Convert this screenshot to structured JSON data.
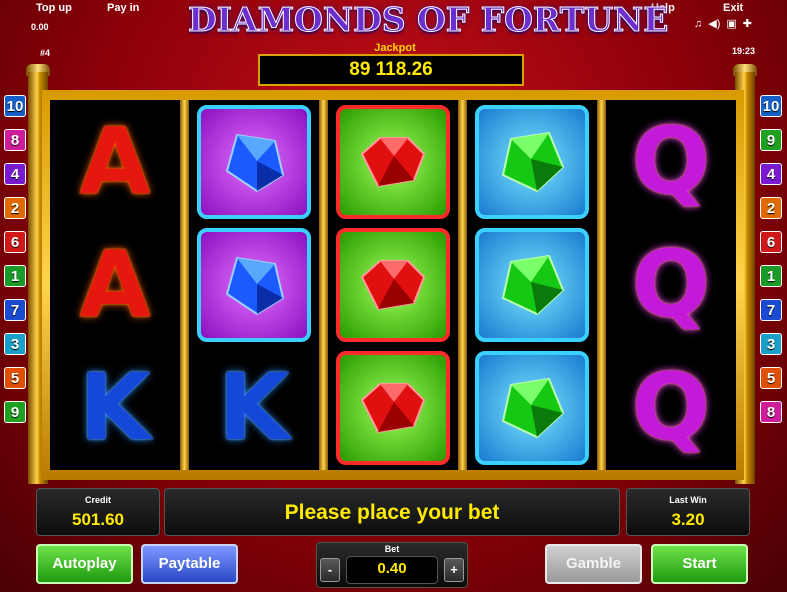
{
  "topbar": {
    "top_up": "Top up",
    "pay_in": "Pay in",
    "help": "Help",
    "exit": "Exit",
    "balance": "0.00",
    "game_id": "#4",
    "clock": "19:23",
    "icons": [
      "music-icon",
      "sound-icon",
      "settings-icon",
      "fullscreen-icon"
    ]
  },
  "title": "DIAMONDS OF FORTUNE",
  "jackpot": {
    "label": "Jackpot",
    "value": "89 118.26"
  },
  "paylines_left": [
    {
      "n": "10",
      "color": "#1560c8"
    },
    {
      "n": "8",
      "color": "#d01c9a"
    },
    {
      "n": "4",
      "color": "#7a1ad0"
    },
    {
      "n": "2",
      "color": "#e06a00"
    },
    {
      "n": "6",
      "color": "#d01818"
    },
    {
      "n": "1",
      "color": "#1a9a28"
    },
    {
      "n": "7",
      "color": "#1a4ad0"
    },
    {
      "n": "3",
      "color": "#1aa0c8"
    },
    {
      "n": "5",
      "color": "#e05000"
    },
    {
      "n": "9",
      "color": "#20a020"
    }
  ],
  "paylines_right": [
    {
      "n": "10",
      "color": "#1560c8"
    },
    {
      "n": "9",
      "color": "#20a020"
    },
    {
      "n": "4",
      "color": "#7a1ad0"
    },
    {
      "n": "2",
      "color": "#e06a00"
    },
    {
      "n": "6",
      "color": "#d01818"
    },
    {
      "n": "1",
      "color": "#1a9a28"
    },
    {
      "n": "7",
      "color": "#1a4ad0"
    },
    {
      "n": "3",
      "color": "#1aa0c8"
    },
    {
      "n": "5",
      "color": "#e05000"
    },
    {
      "n": "8",
      "color": "#d01c9a"
    }
  ],
  "reels": [
    {
      "symbols": [
        "A",
        "A",
        "K"
      ],
      "colors": [
        "red",
        "red",
        "blue"
      ]
    },
    {
      "symbols": [
        "blue-diamond",
        "blue-diamond",
        "K"
      ],
      "colors": [
        "blue",
        "blue",
        "blue"
      ]
    },
    {
      "symbols": [
        "red-ruby",
        "red-ruby",
        "red-ruby"
      ],
      "colors": [
        "red",
        "red",
        "red"
      ]
    },
    {
      "symbols": [
        "green-emerald",
        "green-emerald",
        "green-emerald"
      ],
      "colors": [
        "green",
        "green",
        "green"
      ]
    },
    {
      "symbols": [
        "Q",
        "Q",
        "Q"
      ],
      "colors": [
        "purple",
        "purple",
        "purple"
      ]
    }
  ],
  "credit": {
    "label": "Credit",
    "value": "501.60"
  },
  "message": "Please place your bet",
  "last_win": {
    "label": "Last Win",
    "value": "3.20"
  },
  "buttons": {
    "autoplay": "Autoplay",
    "paytable": "Paytable",
    "gamble": "Gamble",
    "start": "Start"
  },
  "bet": {
    "label": "Bet",
    "value": "0.40",
    "minus": "-",
    "plus": "+"
  }
}
